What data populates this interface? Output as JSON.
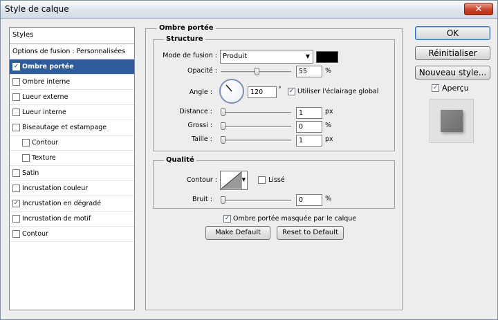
{
  "window": {
    "title": "Style de calque"
  },
  "styles_panel": {
    "header": "Styles",
    "items": [
      {
        "label": "Options de fusion : Personnalisées",
        "checkbox": false,
        "checked": false,
        "selected": false,
        "indent": false
      },
      {
        "label": "Ombre portée",
        "checkbox": true,
        "checked": true,
        "selected": true,
        "indent": false
      },
      {
        "label": "Ombre interne",
        "checkbox": true,
        "checked": false,
        "selected": false,
        "indent": false
      },
      {
        "label": "Lueur externe",
        "checkbox": true,
        "checked": false,
        "selected": false,
        "indent": false
      },
      {
        "label": "Lueur interne",
        "checkbox": true,
        "checked": false,
        "selected": false,
        "indent": false
      },
      {
        "label": "Biseautage et estampage",
        "checkbox": true,
        "checked": false,
        "selected": false,
        "indent": false
      },
      {
        "label": "Contour",
        "checkbox": true,
        "checked": false,
        "selected": false,
        "indent": true
      },
      {
        "label": "Texture",
        "checkbox": true,
        "checked": false,
        "selected": false,
        "indent": true
      },
      {
        "label": "Satin",
        "checkbox": true,
        "checked": false,
        "selected": false,
        "indent": false
      },
      {
        "label": "Incrustation couleur",
        "checkbox": true,
        "checked": false,
        "selected": false,
        "indent": false
      },
      {
        "label": "Incrustation en dégradé",
        "checkbox": true,
        "checked": true,
        "selected": false,
        "indent": false
      },
      {
        "label": "Incrustation de motif",
        "checkbox": true,
        "checked": false,
        "selected": false,
        "indent": false
      },
      {
        "label": "Contour",
        "checkbox": true,
        "checked": false,
        "selected": false,
        "indent": false
      }
    ]
  },
  "drop_shadow": {
    "section_title": "Ombre portée",
    "structure": {
      "title": "Structure",
      "blend_mode_label": "Mode de fusion :",
      "blend_mode_value": "Produit",
      "shadow_color": "#000000",
      "opacity_label": "Opacité :",
      "opacity_value": "55",
      "opacity_fraction": 0.55,
      "opacity_unit": "%",
      "angle_label": "Angle :",
      "angle_value": "120",
      "angle_unit": "°",
      "global_light_label": "Utiliser l'éclairage global",
      "global_light_checked": true,
      "distance_label": "Distance :",
      "distance_value": "1",
      "distance_unit": "px",
      "spread_label": "Grossi :",
      "spread_value": "0",
      "spread_unit": "%",
      "size_label": "Taille :",
      "size_value": "1",
      "size_unit": "px"
    },
    "quality": {
      "title": "Qualité",
      "contour_label": "Contour :",
      "antialias_label": "Lissé",
      "antialias_checked": false,
      "noise_label": "Bruit :",
      "noise_value": "0",
      "noise_unit": "%"
    },
    "knockout_label": "Ombre portée masquée par le calque",
    "knockout_checked": true,
    "make_default_label": "Make Default",
    "reset_default_label": "Reset to Default"
  },
  "right_panel": {
    "ok_label": "OK",
    "reset_label": "Réinitialiser",
    "new_style_label": "Nouveau style...",
    "preview_label": "Aperçu",
    "preview_checked": true
  },
  "icons": {
    "check": "✓",
    "close": "✕",
    "dropdown": "▼"
  }
}
